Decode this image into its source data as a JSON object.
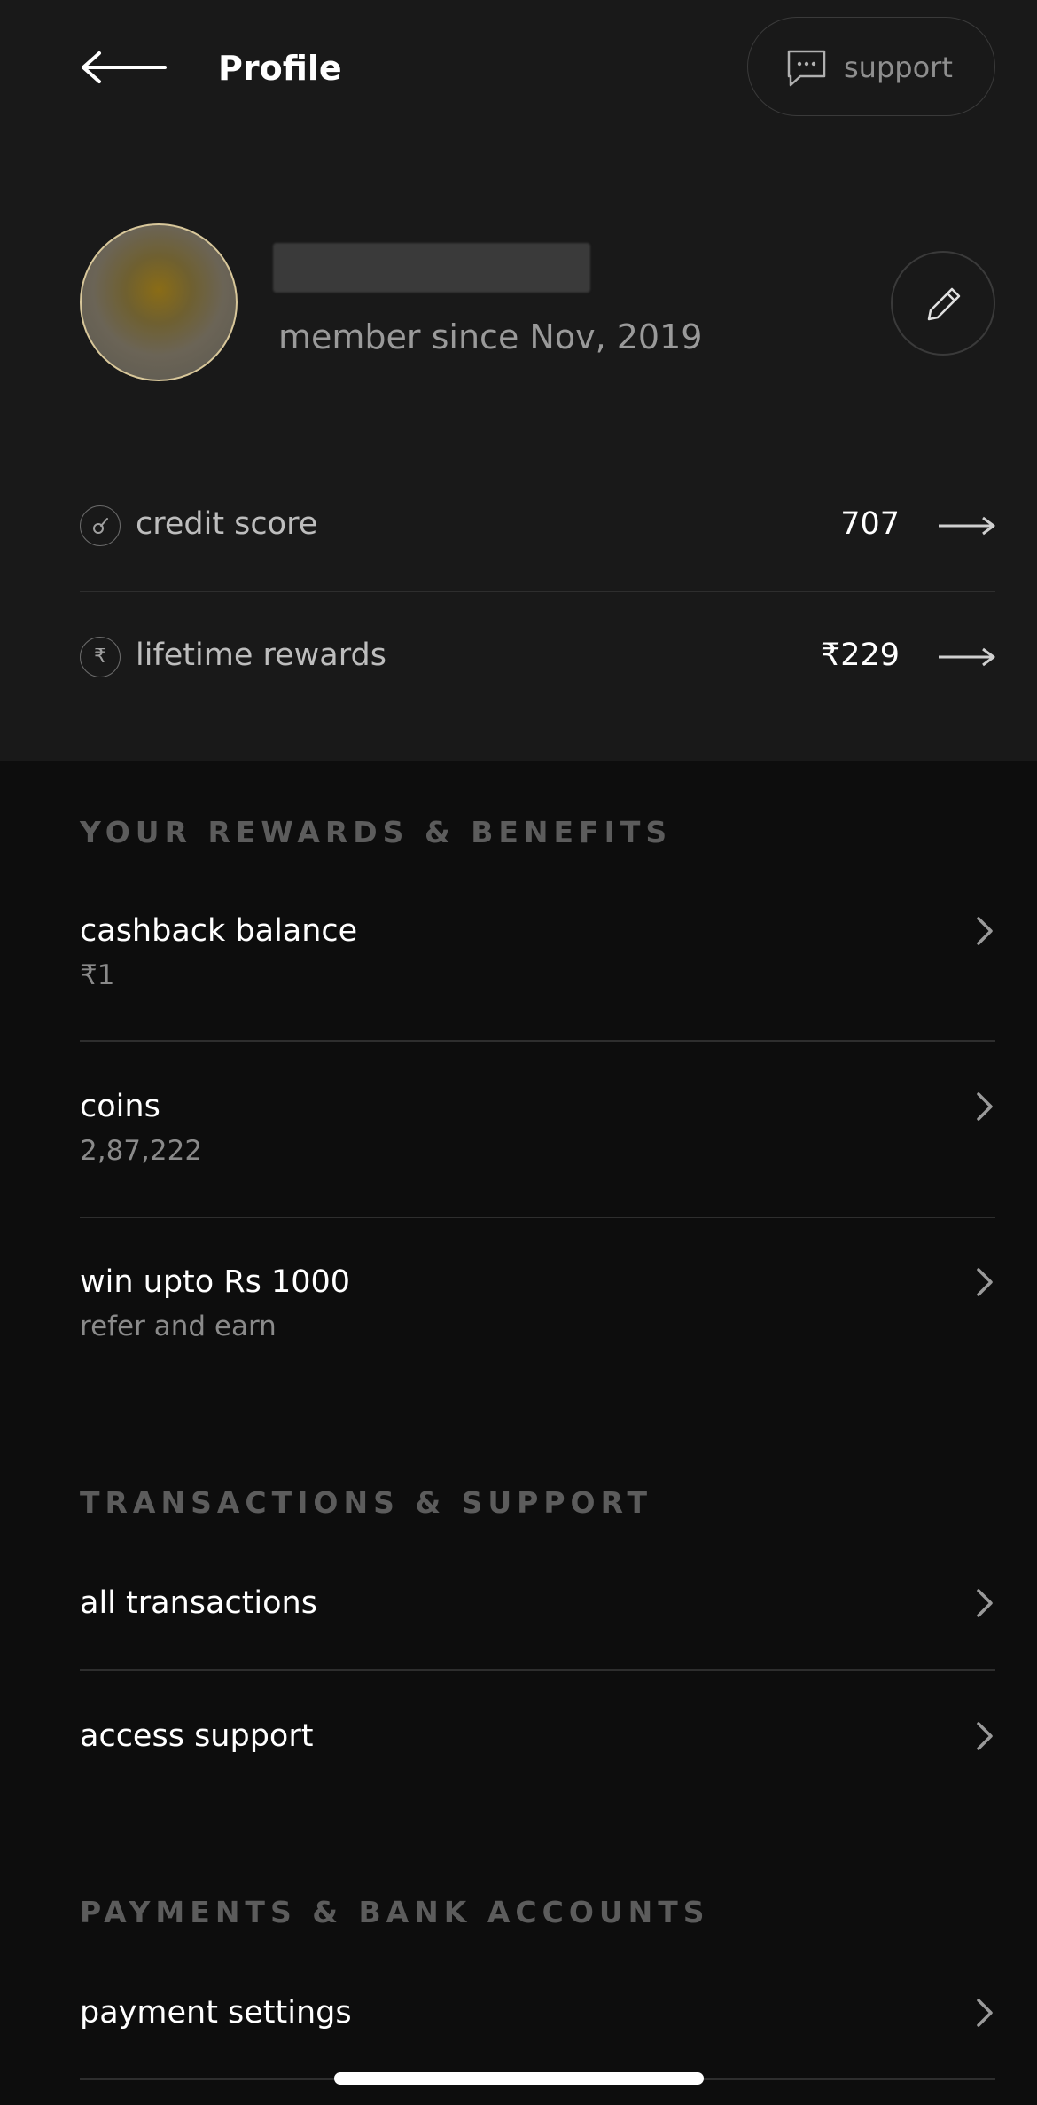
{
  "header": {
    "title": "Profile",
    "support_label": "support"
  },
  "profile": {
    "member_since": "member since Nov, 2019"
  },
  "stats": [
    {
      "label": "credit score",
      "value": "707"
    },
    {
      "label": "lifetime rewards",
      "value": "₹229",
      "icon_glyph": "₹"
    }
  ],
  "sections": {
    "rewards": {
      "title": "YOUR REWARDS & BENEFITS",
      "items": [
        {
          "label": "cashback balance",
          "sub": "₹1"
        },
        {
          "label": "coins",
          "sub": "2,87,222"
        },
        {
          "label": "win upto Rs 1000",
          "sub": "refer and earn"
        }
      ]
    },
    "transactions": {
      "title": "TRANSACTIONS & SUPPORT",
      "items": [
        {
          "label": "all transactions"
        },
        {
          "label": "access support"
        }
      ]
    },
    "payments": {
      "title": "PAYMENTS & BANK ACCOUNTS",
      "items": [
        {
          "label": "payment settings"
        }
      ]
    }
  },
  "icons": {
    "back": "back-arrow-icon",
    "support": "chat-bubble-icon",
    "edit": "pencil-icon",
    "credit": "gauge-icon",
    "rewards": "rupee-icon",
    "row_arrow": "long-arrow-right-icon",
    "chevron": "chevron-right-icon"
  },
  "colors": {
    "top_bg": "#191919",
    "page_bg": "#0d0d0d",
    "text": "#ffffff",
    "muted": "#8a8a8a",
    "section": "#5c5c5c",
    "avatar_ring": "#d8c79a"
  }
}
